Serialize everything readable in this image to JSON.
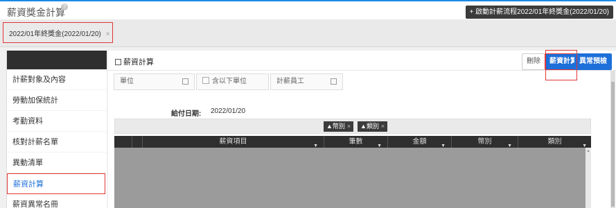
{
  "app": {
    "title": "薪資獎金計算",
    "help_glyph": "?"
  },
  "header": {
    "start_button": "+ 啟動計薪流程2022/01年終獎金(2022/01/20)"
  },
  "tabs": [
    {
      "label": "2022/01年終獎金(2022/01/20)",
      "close": "×"
    }
  ],
  "sidebar": {
    "items": [
      {
        "label": "計薪對象及內容"
      },
      {
        "label": "勞動加保統計"
      },
      {
        "label": "考勤資料"
      },
      {
        "label": "核對計薪名單"
      },
      {
        "label": "異動清單"
      },
      {
        "label": "薪資計算",
        "active": true
      },
      {
        "label": "薪資異常名冊"
      }
    ]
  },
  "main": {
    "title": "薪資計算",
    "buttons": {
      "delete": "刪除",
      "calculate": "薪資計算",
      "anomaly": "異常預檢"
    },
    "filters": {
      "unit": "單位",
      "include_sub": "含以下單位",
      "staff": "計薪員工"
    },
    "pay_date_label": "給付日期:",
    "pay_date_value": "2022/01/20",
    "group_chips": [
      {
        "label": "▲幣別",
        "close": "×"
      },
      {
        "label": "▲類別",
        "close": "×"
      }
    ],
    "grid_columns": [
      "薪資項目",
      "筆數",
      "金額",
      "幣別",
      "類別"
    ]
  },
  "colors": {
    "accent": "#1d6fd9",
    "highlight": "#e03535",
    "dark": "#2f2f2f",
    "top_border": "#1d87e4"
  },
  "icons": {
    "help": "help-icon",
    "edit": "edit-icon",
    "external": "external-link-icon",
    "filter": "filter-icon",
    "close": "close-icon"
  }
}
